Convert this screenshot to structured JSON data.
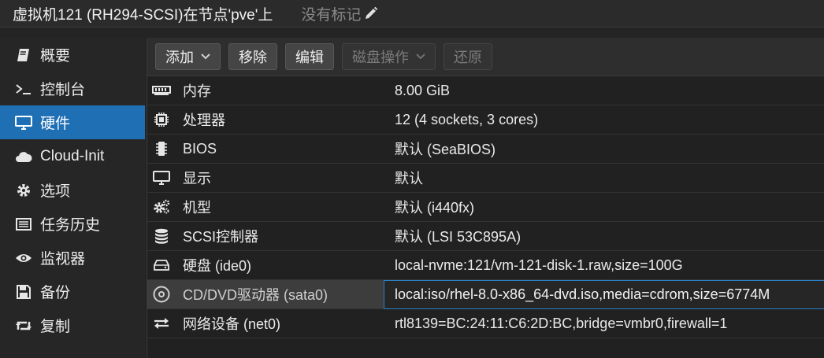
{
  "title": "虚拟机121 (RH294-SCSI)在节点'pve'上",
  "tags_label": "没有标记",
  "sidebar": {
    "items": [
      {
        "label": "概要",
        "icon": "book-icon"
      },
      {
        "label": "控制台",
        "icon": "terminal-icon"
      },
      {
        "label": "硬件",
        "icon": "monitor-icon",
        "active": true
      },
      {
        "label": "Cloud-Init",
        "icon": "cloud-icon"
      },
      {
        "label": "选项",
        "icon": "gear-icon"
      },
      {
        "label": "任务历史",
        "icon": "list-icon"
      },
      {
        "label": "监视器",
        "icon": "eye-icon"
      },
      {
        "label": "备份",
        "icon": "floppy-icon"
      },
      {
        "label": "复制",
        "icon": "retweet-icon"
      }
    ]
  },
  "toolbar": {
    "add": "添加",
    "remove": "移除",
    "edit": "编辑",
    "disk_action": "磁盘操作",
    "revert": "还原"
  },
  "hardware": [
    {
      "key": "内存",
      "value": "8.00 GiB",
      "icon": "memory-icon"
    },
    {
      "key": "处理器",
      "value": "12 (4 sockets, 3 cores)",
      "icon": "cpu-icon"
    },
    {
      "key": "BIOS",
      "value": "默认 (SeaBIOS)",
      "icon": "chip-icon"
    },
    {
      "key": "显示",
      "value": "默认",
      "icon": "display-icon"
    },
    {
      "key": "机型",
      "value": "默认 (i440fx)",
      "icon": "cogs-icon"
    },
    {
      "key": "SCSI控制器",
      "value": "默认 (LSI 53C895A)",
      "icon": "database-icon"
    },
    {
      "key": "硬盘 (ide0)",
      "value": "local-nvme:121/vm-121-disk-1.raw,size=100G",
      "icon": "hdd-icon"
    },
    {
      "key": "CD/DVD驱动器 (sata0)",
      "value": "local:iso/rhel-8.0-x86_64-dvd.iso,media=cdrom,size=6774M",
      "icon": "cdrom-icon",
      "selected": true
    },
    {
      "key": "网络设备 (net0)",
      "value": "rtl8139=BC:24:11:C6:2D:BC,bridge=vmbr0,firewall=1",
      "icon": "exchange-icon"
    }
  ]
}
